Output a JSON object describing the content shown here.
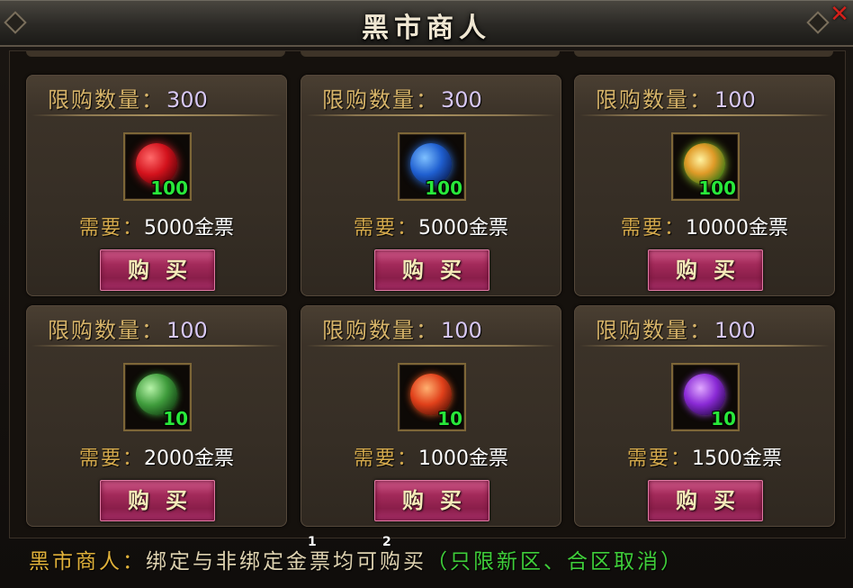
{
  "window": {
    "title": "黑市商人",
    "close_icon": "close-x-icon"
  },
  "cards": [
    {
      "limit_label": "限购数量：",
      "limit": "300",
      "item_icon": "red-orb-icon",
      "count": "100",
      "price_label": "需要：",
      "price": "5000金票",
      "buy_label": "购买"
    },
    {
      "limit_label": "限购数量：",
      "limit": "300",
      "item_icon": "blue-orb-icon",
      "count": "100",
      "price_label": "需要：",
      "price": "5000金票",
      "buy_label": "购买"
    },
    {
      "limit_label": "限购数量：",
      "limit": "100",
      "item_icon": "gold-green-orb-icon",
      "count": "100",
      "price_label": "需要：",
      "price": "10000金票",
      "buy_label": "购买"
    },
    {
      "limit_label": "限购数量：",
      "limit": "100",
      "item_icon": "green-orb-icon",
      "count": "10",
      "price_label": "需要：",
      "price": "2000金票",
      "buy_label": "购买"
    },
    {
      "limit_label": "限购数量：",
      "limit": "100",
      "item_icon": "orange-orb-icon",
      "count": "10",
      "price_label": "需要：",
      "price": "1000金票",
      "buy_label": "购买"
    },
    {
      "limit_label": "限购数量：",
      "limit": "100",
      "item_icon": "purple-orb-icon",
      "count": "10",
      "price_label": "需要：",
      "price": "1500金票",
      "buy_label": "购买"
    }
  ],
  "notice": {
    "speaker": "黑市商人：",
    "text": "绑定与非绑定金票均可购买",
    "note": "（只限新区、合区取消）"
  },
  "markers": [
    "1",
    "2"
  ],
  "colors": {
    "buy_button": "#a32a5a",
    "limit_value": "#d8c8f4",
    "count": "#28e83a",
    "label_gold": "#d4a94c",
    "notice_green": "#3fce3a"
  }
}
